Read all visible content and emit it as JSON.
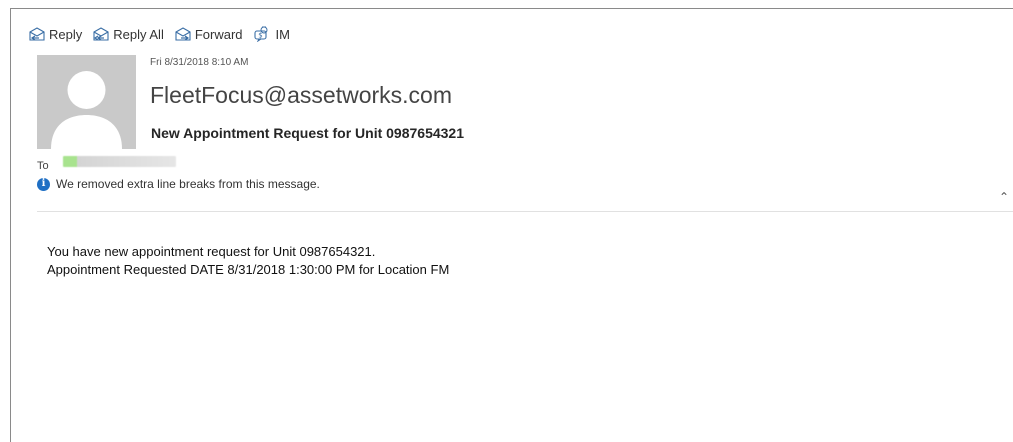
{
  "toolbar": {
    "reply_label": "Reply",
    "reply_all_label": "Reply All",
    "forward_label": "Forward",
    "im_label": "IM"
  },
  "message": {
    "date": "Fri 8/31/2018 8:10 AM",
    "sender": "FleetFocus@assetworks.com",
    "subject": "New Appointment Request for Unit 0987654321",
    "to_label": "To",
    "info_text": "We removed extra line breaks from this message.",
    "body_lines": [
      "You have new appointment request for Unit 0987654321.",
      "Appointment Requested DATE 8/31/2018 1:30:00 PM for Location FM"
    ]
  },
  "icons": {
    "reply": "reply-icon",
    "reply_all": "reply-all-icon",
    "forward": "forward-icon",
    "im": "im-icon",
    "avatar": "avatar-placeholder",
    "info": "info-icon",
    "collapse": "chevron-up-icon"
  },
  "colors": {
    "info_icon": "#1f6fc4",
    "avatar_bg": "#c9c9c9",
    "icon_blue": "#3a6ea5"
  }
}
